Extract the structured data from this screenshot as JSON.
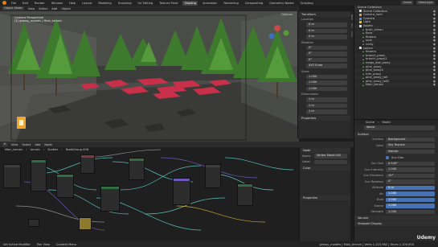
{
  "topbar": {
    "menus": [
      "File",
      "Edit",
      "Render",
      "Window",
      "Help"
    ],
    "workspaces": [
      "Layout",
      "Modeling",
      "Sculpting",
      "UV Editing",
      "Texture Paint",
      "Shading",
      "Animation",
      "Rendering",
      "Compositing",
      "Geometry Nodes",
      "Scripting"
    ],
    "active_workspace": "Shading",
    "scene": "Scene",
    "view_layer": "ViewLayer"
  },
  "viewport": {
    "mode": "Object Mode",
    "menus": [
      "View",
      "Select",
      "Add",
      "Object"
    ],
    "camera_label": "Camera Perspective",
    "object_label": "(1) grassy_models | Main_terrain",
    "options_label": "Options"
  },
  "npanel": {
    "transform_header": "Transform",
    "location_label": "Location",
    "location": [
      "0 m",
      "0 m",
      "0 m"
    ],
    "rotation_label": "Rotation",
    "rotation": [
      "0°",
      "0°",
      "0°"
    ],
    "mode_label": "XYZ Euler",
    "scale_label": "Scale",
    "scale": [
      "1.000",
      "1.000",
      "1.000"
    ],
    "dimensions_label": "Dimensions",
    "dimensions": [
      "1 m",
      "1 m",
      "1 m"
    ],
    "properties_header": "Properties",
    "tabs": [
      "Item",
      "Tool",
      "View"
    ]
  },
  "outliner": {
    "header": "Scene Collection",
    "items": [
      {
        "name": "Scene Collection",
        "icon": "collection"
      },
      {
        "name": "Camera_hold",
        "icon": "object"
      },
      {
        "name": "Camera",
        "icon": "camera"
      },
      {
        "name": "Light",
        "icon": "light"
      },
      {
        "name": "Assets",
        "icon": "collection"
      },
      {
        "name": "bush_ximan",
        "icon": "mesh"
      },
      {
        "name": "flora",
        "icon": "mesh"
      },
      {
        "name": "flowers",
        "icon": "mesh"
      },
      {
        "name": "rock",
        "icon": "mesh"
      },
      {
        "name": "rocky",
        "icon": "mesh"
      },
      {
        "name": "nature",
        "icon": "collection"
      },
      {
        "name": "flowers",
        "icon": "mesh"
      },
      {
        "name": "branch_proxy",
        "icon": "mesh"
      },
      {
        "name": "branch_proxy2",
        "icon": "mesh"
      },
      {
        "name": "mega_leaf_proxy",
        "icon": "mesh"
      },
      {
        "name": "pine_proxy",
        "icon": "mesh"
      },
      {
        "name": "pine_proxy2",
        "icon": "mesh"
      },
      {
        "name": "trim_proxy",
        "icon": "mesh"
      },
      {
        "name": "pine_proxy_tall",
        "icon": "mesh"
      },
      {
        "name": "pine_proxy_tall2",
        "icon": "mesh"
      },
      {
        "name": "Main_terrain",
        "icon": "mesh"
      }
    ]
  },
  "properties": {
    "breadcrumb_scene": "Scene",
    "breadcrumb_world": "World",
    "world_name": "World",
    "surface_header": "Surface",
    "surface_label": "Surface",
    "surface_value": "Background",
    "color_label": "Color",
    "color_value": "Sky Texture",
    "sky_type": "Nishita",
    "sun_disc_label": "Sun Disc",
    "rows": [
      {
        "label": "Sun Size",
        "value": "0.545°"
      },
      {
        "label": "Sun Intensity",
        "value": "1.000"
      },
      {
        "label": "Sun Elevation",
        "value": "10°"
      },
      {
        "label": "Sun Rotation",
        "value": "0°"
      },
      {
        "label": "Altitude",
        "value": "0 m"
      },
      {
        "label": "Air",
        "value": "1.000"
      },
      {
        "label": "Dust",
        "value": "1.000"
      },
      {
        "label": "Ozone",
        "value": "1.000"
      },
      {
        "label": "Strength",
        "value": "1.000"
      }
    ],
    "volume_header": "Volume",
    "viewport_display_header": "Viewport Display"
  },
  "node_editor": {
    "header_menus": [
      "View",
      "Select",
      "Add",
      "Node"
    ],
    "breadcrumb": [
      "Main_terrain",
      "terrain",
      "Scatter",
      "NodeGroup.006"
    ],
    "panel_tab": "Node",
    "node_name_label": "Name",
    "node_name_value": "Vertex Mesh.002",
    "node_label_label": "Label",
    "color_header": "Color",
    "properties_header": "Properties",
    "nodes": [
      {
        "title": "Group Input",
        "color": "#3d3d3d"
      },
      {
        "title": "Distribute Points",
        "color": "#2f6e3e"
      },
      {
        "title": "Instance on Points",
        "color": "#2f6e3e"
      },
      {
        "title": "Random Value",
        "color": "#7d3b3b"
      },
      {
        "title": "Join Geometry",
        "color": "#2f6e3e"
      },
      {
        "title": "Realize Instances",
        "color": "#2f6e3e"
      },
      {
        "title": "Set Material",
        "color": "#2f6e3e"
      },
      {
        "title": "Group Output",
        "color": "#3d3d3d"
      }
    ]
  },
  "statusbar": {
    "items": [
      "Set Active Modifier",
      "Pan View",
      "Context Menu"
    ],
    "stats": "grassy_models | Main_terrain | Verts 1,223,982 | Faces 1,100,000"
  },
  "watermark": "Udemy",
  "colors": {
    "accent": "#4772b3",
    "orange": "#e87d0d",
    "mesh_green": "#6fb05a",
    "red_flowers": "#c8304a",
    "tree_green": "#4e8f38",
    "node_wire_teal": "#55c1b6"
  }
}
